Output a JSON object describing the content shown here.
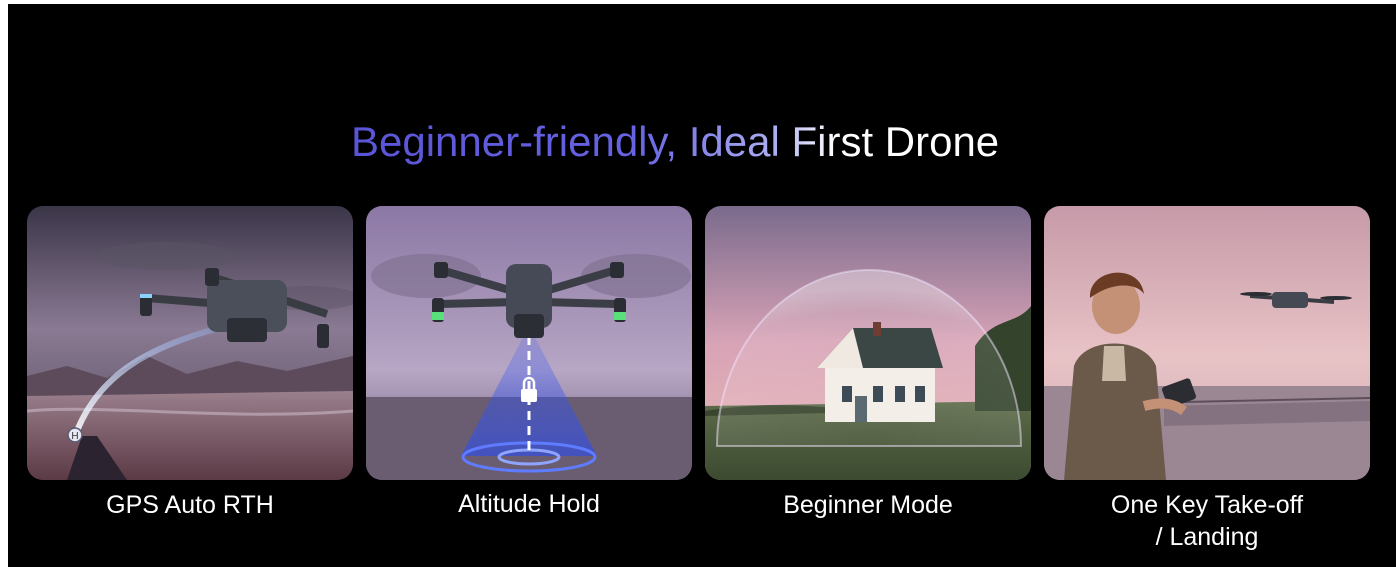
{
  "headline": "Beginner-friendly, Ideal First Drone",
  "features": [
    {
      "label": "GPS Auto RTH"
    },
    {
      "label": "Altitude Hold"
    },
    {
      "label": "Beginner Mode"
    },
    {
      "label_line1": "One Key Take-off",
      "label_line2": "/ Landing"
    }
  ],
  "icons": {
    "home_marker": "H",
    "altitude_lock": "lock-icon"
  },
  "colors": {
    "accent": "#5a54d6",
    "background": "#000000",
    "text": "#ffffff"
  }
}
